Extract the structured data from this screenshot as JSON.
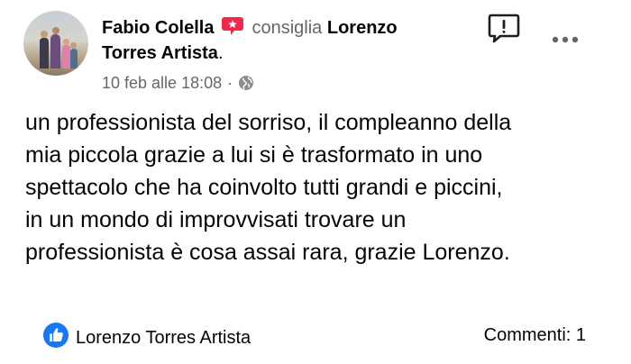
{
  "post": {
    "author": "Fabio Colella",
    "action": "consiglia",
    "page_name_part1": "Lorenzo",
    "page_name_part2": "Torres Artista",
    "page_name_suffix": ".",
    "timestamp": "10 feb alle 18:08",
    "separator": "·",
    "privacy_icon": "globe-icon",
    "body_lines": [
      "un professionista del sorriso, il compleanno della",
      "mia piccola grazie a lui si è trasformato in uno",
      "spettacolo che ha coinvolto tutti grandi e piccini,",
      "in un mondo di improvvisati trovare un",
      "professionista è cosa assai rara, grazie Lorenzo."
    ]
  },
  "footer": {
    "reaction_icon": "like-icon",
    "reaction_by": "Lorenzo Torres Artista",
    "comments_label": "Commenti: 1"
  },
  "colors": {
    "recommend_badge": "#f02849",
    "like_blue": "#1877f2",
    "muted_text": "#65676b"
  }
}
